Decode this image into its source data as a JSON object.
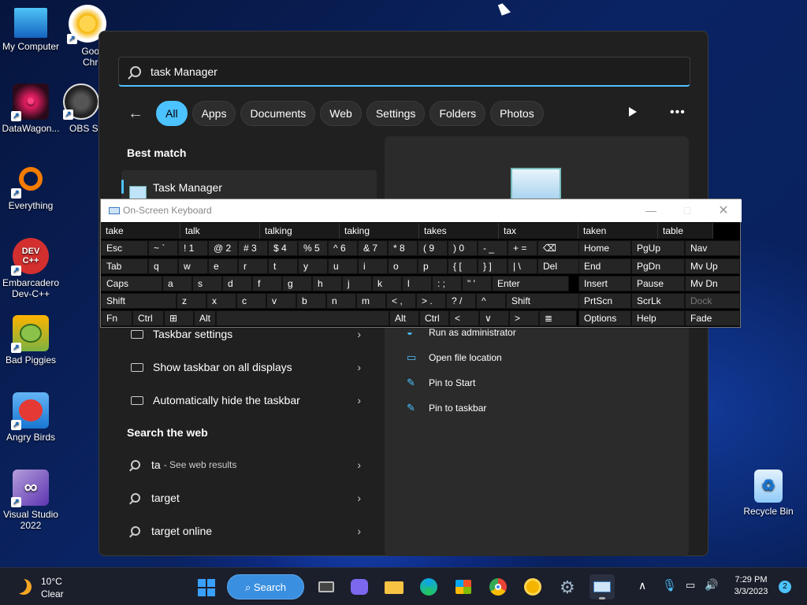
{
  "desktop": {
    "icons": [
      {
        "label": "My Computer",
        "color": "#1e90ff",
        "glyph": "▭"
      },
      {
        "label": "Goog Chro",
        "color": "#f5b400",
        "glyph": "●"
      },
      {
        "label": "DataWagon...",
        "color": "#c2185b",
        "glyph": "✺"
      },
      {
        "label": "OBS Stu",
        "color": "#333333",
        "glyph": "◉"
      },
      {
        "label": "Everything",
        "color": "#f57c00",
        "glyph": "O"
      },
      {
        "label": "Embarcadero Dev-C++",
        "color": "#d32f2f",
        "glyph": "DEV C++"
      },
      {
        "label": "Bad Piggies",
        "color": "#7cb342",
        "glyph": "🐷"
      },
      {
        "label": "Angry Birds",
        "color": "#e53935",
        "glyph": "🐦"
      },
      {
        "label": "Visual Studio 2022",
        "color": "#7e57c2",
        "glyph": "∞"
      },
      {
        "label": "Recycle Bin",
        "color": "#90caf9",
        "glyph": "♻"
      }
    ]
  },
  "start": {
    "search_value": "task Manager",
    "filters": [
      "All",
      "Apps",
      "Documents",
      "Web",
      "Settings",
      "Folders",
      "Photos"
    ],
    "active_filter": "All",
    "best_match_heading": "Best match",
    "best_match_item": "Task Manager",
    "settings_rows": [
      "Taskbar settings",
      "Show taskbar on all displays",
      "Automatically hide the taskbar"
    ],
    "web_heading": "Search the web",
    "web_rows": [
      {
        "label": "ta",
        "sub": "- See web results"
      },
      {
        "label": "target",
        "sub": ""
      },
      {
        "label": "target online",
        "sub": ""
      }
    ],
    "actions": [
      "Run as administrator",
      "Open file location",
      "Pin to Start",
      "Pin to taskbar"
    ]
  },
  "osk": {
    "title": "On-Screen Keyboard",
    "predictions": [
      "take",
      "talk",
      "talking",
      "taking",
      "takes",
      "tax",
      "taken",
      "table"
    ],
    "row1": [
      [
        "Esc",
        ""
      ],
      [
        "~ `",
        ""
      ],
      [
        "! 1",
        ""
      ],
      [
        "@ 2",
        ""
      ],
      [
        "# 3",
        ""
      ],
      [
        "$ 4",
        ""
      ],
      [
        "% 5",
        ""
      ],
      [
        "^ 6",
        ""
      ],
      [
        "& 7",
        ""
      ],
      [
        "* 8",
        ""
      ],
      [
        "( 9",
        ""
      ],
      [
        ") 0",
        ""
      ],
      [
        "- _",
        ""
      ],
      [
        "+ =",
        ""
      ],
      [
        "⌫",
        ""
      ]
    ],
    "row2": [
      "Tab",
      "q",
      "w",
      "e",
      "r",
      "t",
      "y",
      "u",
      "i",
      "o",
      "p",
      "{ [",
      "} ]",
      "| \\",
      "Del"
    ],
    "row3": [
      "Caps",
      "a",
      "s",
      "d",
      "f",
      "g",
      "h",
      "j",
      "k",
      "l",
      ": ;",
      "\" '",
      "Enter"
    ],
    "row4": [
      "Shift",
      "z",
      "x",
      "c",
      "v",
      "b",
      "n",
      "m",
      "< ,",
      "> .",
      "? /",
      "^",
      "Shift"
    ],
    "row5": [
      "Fn",
      "Ctrl",
      "⊞",
      "Alt",
      "",
      "Alt",
      "Ctrl",
      "<",
      "∨",
      ">",
      "≣"
    ],
    "nav": [
      [
        "Home",
        "PgUp",
        "Nav"
      ],
      [
        "End",
        "PgDn",
        "Mv Up"
      ],
      [
        "Insert",
        "Pause",
        "Mv Dn"
      ],
      [
        "PrtScn",
        "ScrLk",
        "Dock"
      ],
      [
        "Options",
        "Help",
        "Fade"
      ]
    ]
  },
  "taskbar": {
    "weather_temp": "10°C",
    "weather_desc": "Clear",
    "search_label": "Search",
    "time": "7:29 PM",
    "date": "3/3/2023",
    "notifications": "2"
  }
}
